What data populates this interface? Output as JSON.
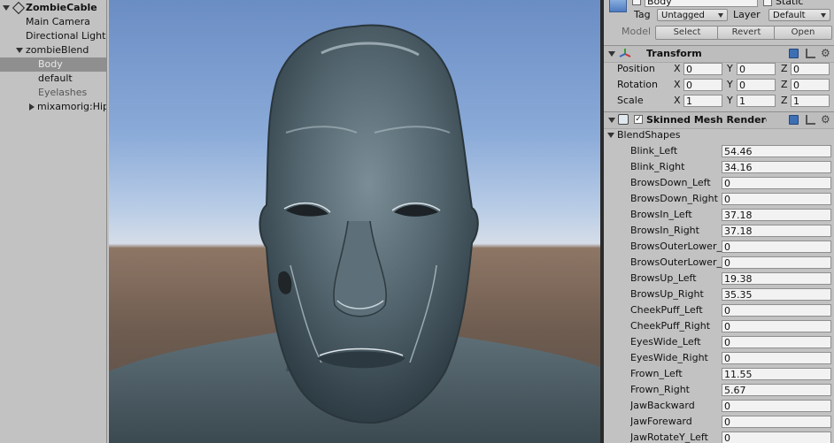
{
  "hierarchy": {
    "root": "ZombieCable",
    "items": [
      {
        "label": "Main Camera"
      },
      {
        "label": "Directional Light"
      },
      {
        "label": "zombieBlend"
      },
      {
        "label": "Body"
      },
      {
        "label": "default"
      },
      {
        "label": "Eyelashes"
      },
      {
        "label": "mixamorig:Hips"
      }
    ]
  },
  "inspector": {
    "object_name": "Body",
    "static_label": "Static",
    "tag_label": "Tag",
    "tag_value": "Untagged",
    "layer_label": "Layer",
    "layer_value": "Default",
    "model_label": "Model",
    "model_buttons": [
      "Select",
      "Revert",
      "Open"
    ],
    "transform": {
      "title": "Transform",
      "rows": [
        {
          "label": "Position",
          "x": "0",
          "y": "0",
          "z": "0"
        },
        {
          "label": "Rotation",
          "x": "0",
          "y": "0",
          "z": "0"
        },
        {
          "label": "Scale",
          "x": "1",
          "y": "1",
          "z": "1"
        }
      ],
      "axis_labels": [
        "X",
        "Y",
        "Z"
      ]
    },
    "skinned_mesh": {
      "title": "Skinned Mesh Renderer",
      "blendshapes_label": "BlendShapes",
      "blendshapes": [
        {
          "name": "Blink_Left",
          "value": "54.46"
        },
        {
          "name": "Blink_Right",
          "value": "34.16"
        },
        {
          "name": "BrowsDown_Left",
          "value": "0"
        },
        {
          "name": "BrowsDown_Right",
          "value": "0"
        },
        {
          "name": "BrowsIn_Left",
          "value": "37.18"
        },
        {
          "name": "BrowsIn_Right",
          "value": "37.18"
        },
        {
          "name": "BrowsOuterLower_Left",
          "value": "0"
        },
        {
          "name": "BrowsOuterLower_Right",
          "value": "0"
        },
        {
          "name": "BrowsUp_Left",
          "value": "19.38"
        },
        {
          "name": "BrowsUp_Right",
          "value": "35.35"
        },
        {
          "name": "CheekPuff_Left",
          "value": "0"
        },
        {
          "name": "CheekPuff_Right",
          "value": "0"
        },
        {
          "name": "EyesWide_Left",
          "value": "0"
        },
        {
          "name": "EyesWide_Right",
          "value": "0"
        },
        {
          "name": "Frown_Left",
          "value": "11.55"
        },
        {
          "name": "Frown_Right",
          "value": "5.67"
        },
        {
          "name": "JawBackward",
          "value": "0"
        },
        {
          "name": "JawForeward",
          "value": "0"
        },
        {
          "name": "JawRotateY_Left",
          "value": "0"
        }
      ]
    }
  },
  "colors": {
    "panel": "#c2c2c2",
    "selection": "#8f8f8f",
    "sky_top": "#6a8dc4",
    "ground": "#6e5c50"
  }
}
